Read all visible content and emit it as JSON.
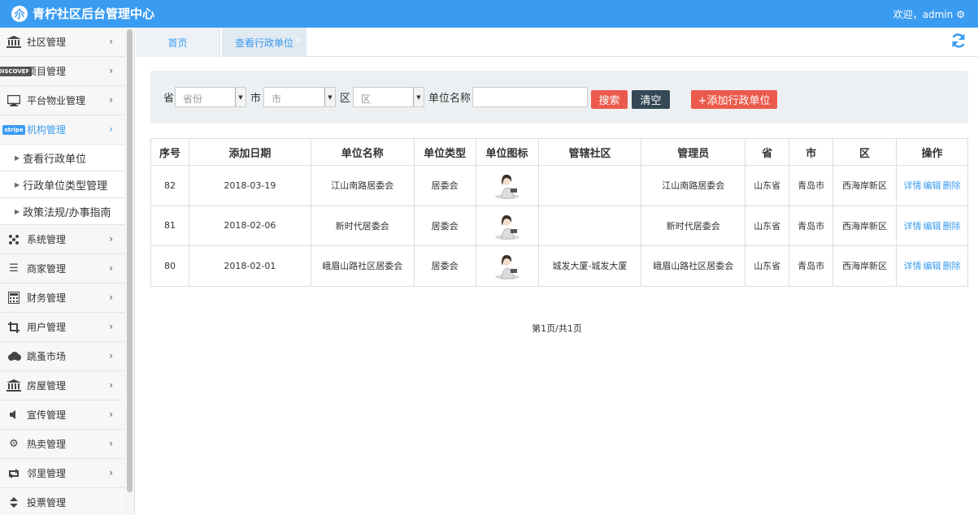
{
  "header": {
    "title": "青柠社区后台管理中心",
    "logo_char": "尒",
    "welcome": "欢迎，admin",
    "settings_icon": "gear-icon"
  },
  "sidebar": {
    "items": [
      {
        "label": "社区管理",
        "icon": "bank-icon"
      },
      {
        "label": "项目管理",
        "icon": "discover-card-icon"
      },
      {
        "label": "平台物业管理",
        "icon": "monitor-icon"
      },
      {
        "label": "机构管理",
        "icon": "stripe-icon",
        "active": true
      },
      {
        "label": "系统管理",
        "icon": "network-icon"
      },
      {
        "label": "商家管理",
        "icon": "list-icon"
      },
      {
        "label": "财务管理",
        "icon": "calculator-icon"
      },
      {
        "label": "用户管理",
        "icon": "crop-icon"
      },
      {
        "label": "跳蚤市场",
        "icon": "cloud-icon"
      },
      {
        "label": "房屋管理",
        "icon": "bank-icon"
      },
      {
        "label": "宣传管理",
        "icon": "volume-icon"
      },
      {
        "label": "热卖管理",
        "icon": "cog-icon"
      },
      {
        "label": "邻里管理",
        "icon": "retweet-icon"
      },
      {
        "label": "投票管理",
        "icon": "sort-icon"
      }
    ],
    "sub_items": [
      {
        "label": "查看行政单位"
      },
      {
        "label": "行政单位类型管理"
      },
      {
        "label": "政策法规/办事指南"
      }
    ],
    "badges": {
      "discover": "DISCOVER",
      "stripe": "stripe"
    }
  },
  "tabs": {
    "home": "首页",
    "current": "查看行政单位",
    "close": "×"
  },
  "filter": {
    "province_label": "省",
    "province_value": "省份",
    "city_label": "市",
    "city_value": "市",
    "district_label": "区",
    "district_value": "区",
    "name_label": "单位名称",
    "name_value": "",
    "search_btn": "搜索",
    "clear_btn": "清空",
    "add_btn": "+添加行政单位"
  },
  "table": {
    "headers": [
      "序号",
      "添加日期",
      "单位名称",
      "单位类型",
      "单位图标",
      "管辖社区",
      "管理员",
      "省",
      "市",
      "区",
      "操作"
    ],
    "rows": [
      {
        "id": "82",
        "date": "2018-03-19",
        "name": "江山南路居委会",
        "type": "居委会",
        "community": "",
        "admin": "江山南路居委会",
        "province": "山东省",
        "city": "青岛市",
        "district": "西海岸新区"
      },
      {
        "id": "81",
        "date": "2018-02-06",
        "name": "新时代居委会",
        "type": "居委会",
        "community": "",
        "admin": "新时代居委会",
        "province": "山东省",
        "city": "青岛市",
        "district": "西海岸新区"
      },
      {
        "id": "80",
        "date": "2018-02-01",
        "name": "峨眉山路社区居委会",
        "type": "居委会",
        "community": "城发大厦-城发大厦",
        "admin": "峨眉山路社区居委会",
        "province": "山东省",
        "city": "青岛市",
        "district": "西海岸新区"
      }
    ],
    "ops": {
      "detail": "详情",
      "edit": "编辑",
      "delete": "删除"
    }
  },
  "pager": "第1页/共1页",
  "colors": {
    "accent": "#3a9cf1",
    "danger": "#eb5a4c",
    "dark": "#344856"
  }
}
